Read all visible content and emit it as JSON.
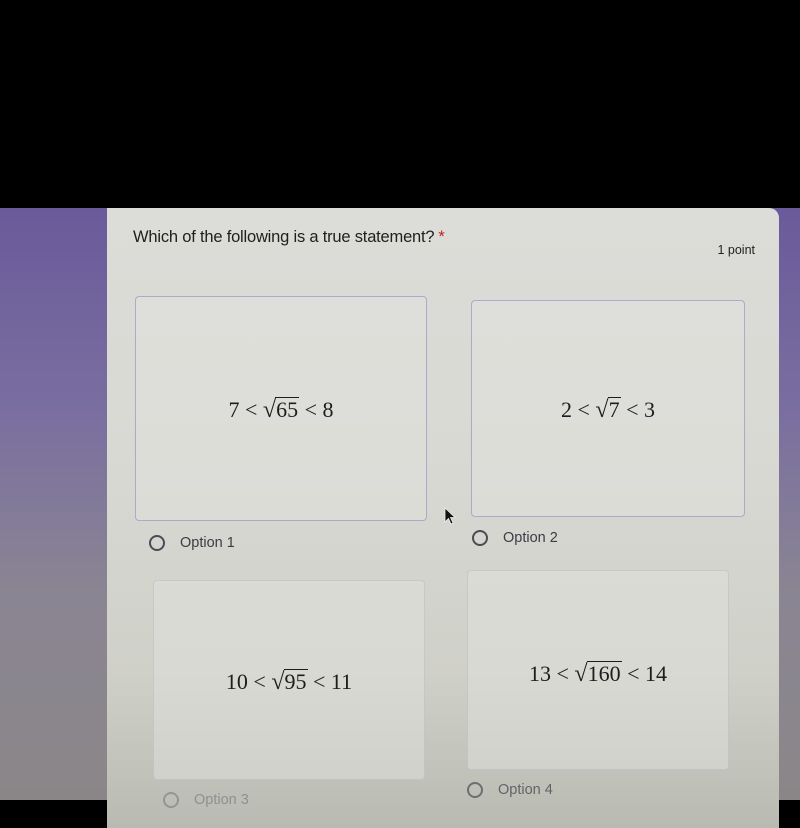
{
  "question": {
    "title": "Which of the following is a true statement?",
    "required_marker": "*",
    "points": "1 point"
  },
  "options": [
    {
      "label": "Option 1",
      "math": {
        "left": "7 <",
        "radicand": "65",
        "right": "< 8"
      },
      "selected": false
    },
    {
      "label": "Option 2",
      "math": {
        "left": "2 <",
        "radicand": "7",
        "right": "< 3"
      },
      "selected": false
    },
    {
      "label": "Option 3",
      "math": {
        "left": "10 <",
        "radicand": "95",
        "right": "< 11"
      },
      "selected": false
    },
    {
      "label": "Option 4",
      "math": {
        "left": "13 <",
        "radicand": "160",
        "right": "< 14"
      },
      "selected": false
    }
  ],
  "colors": {
    "accent_purple": "#6a5a9a",
    "required_red": "#c5221f",
    "card_bg": "#dcdcd8"
  }
}
